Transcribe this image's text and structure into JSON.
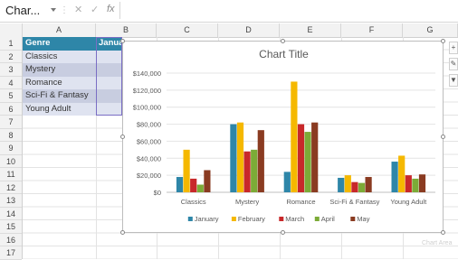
{
  "formula_bar": {
    "name_box": "Char...",
    "fx_label": "fx",
    "cancel_icon": "close-icon",
    "enter_icon": "check-icon"
  },
  "columns": [
    "A",
    "B",
    "C",
    "D",
    "E",
    "F",
    "G"
  ],
  "rows": [
    "1",
    "2",
    "3",
    "4",
    "5",
    "6",
    "7",
    "8",
    "9",
    "10",
    "11",
    "12",
    "13",
    "14",
    "15",
    "16",
    "17"
  ],
  "table": {
    "header": {
      "a": "Genre",
      "b": "Janua"
    },
    "genres": [
      "Classics",
      "Mystery",
      "Romance",
      "Sci-Fi & Fantasy",
      "Young Adult"
    ]
  },
  "side_buttons": [
    "+",
    "brush-icon",
    "filter-icon"
  ],
  "watermark": "Chart Area",
  "chart_data": {
    "type": "bar",
    "title": "Chart Title",
    "categories": [
      "Classics",
      "Mystery",
      "Romance",
      "Sci-Fi & Fantasy",
      "Young Adult"
    ],
    "series": [
      {
        "name": "January",
        "color": "#2e86a8",
        "values": [
          18000,
          80000,
          24000,
          17000,
          36000
        ]
      },
      {
        "name": "February",
        "color": "#f5b800",
        "values": [
          50000,
          82000,
          130000,
          20000,
          43000
        ]
      },
      {
        "name": "March",
        "color": "#c8282a",
        "values": [
          16000,
          48000,
          80000,
          12000,
          20000
        ]
      },
      {
        "name": "April",
        "color": "#7cab37",
        "values": [
          9000,
          50000,
          71000,
          11000,
          16000
        ]
      },
      {
        "name": "May",
        "color": "#8a3b21",
        "values": [
          26000,
          73000,
          82000,
          18000,
          21000
        ]
      }
    ],
    "ylim": [
      0,
      140000
    ],
    "y_ticks": [
      "$0",
      "$20,000",
      "$40,000",
      "$60,000",
      "$80,000",
      "$100,000",
      "$120,000",
      "$140,000"
    ],
    "grid": true,
    "legend_position": "bottom"
  }
}
